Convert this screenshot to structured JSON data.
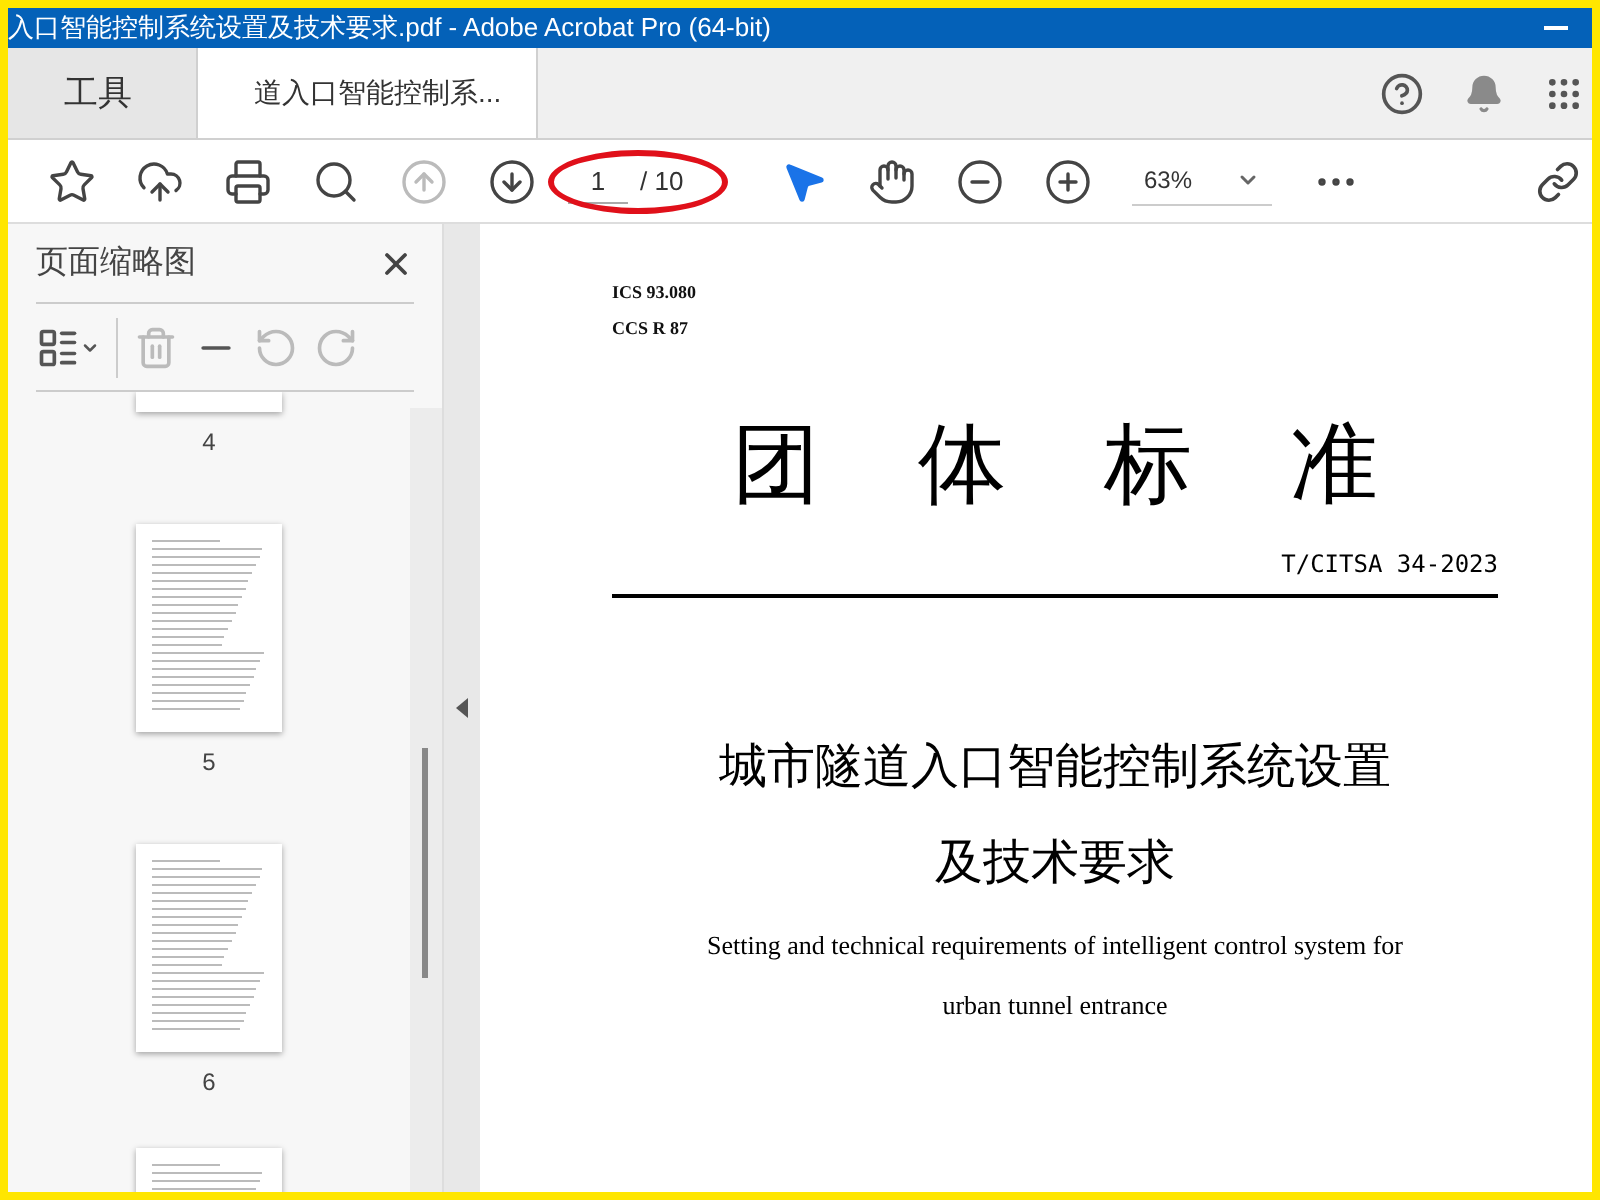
{
  "window": {
    "title": "入口智能控制系统设置及技术要求.pdf - Adobe Acrobat Pro (64-bit)"
  },
  "tabs": [
    {
      "label": "工具",
      "selected": false
    },
    {
      "label": "道入口智能控制系...",
      "selected": true
    }
  ],
  "toolbar": [
    {
      "kind": "star",
      "disabled": false
    },
    {
      "kind": "upload",
      "disabled": false
    },
    {
      "kind": "print",
      "disabled": false
    },
    {
      "kind": "find",
      "disabled": false
    },
    {
      "kind": "prev",
      "disabled": true
    },
    {
      "kind": "next",
      "disabled": false
    },
    {
      "kind": "page"
    },
    {
      "kind": "select",
      "disabled": false
    },
    {
      "kind": "hand",
      "disabled": false
    },
    {
      "kind": "zoom-out",
      "disabled": false
    },
    {
      "kind": "zoom-in",
      "disabled": false
    },
    {
      "kind": "zoom"
    },
    {
      "kind": "more",
      "disabled": false
    }
  ],
  "page_field": {
    "value": "1",
    "total": "/ 10",
    "annotated": true
  },
  "zoom": {
    "value": "63%"
  },
  "sidebar": {
    "title": "页面缩略图",
    "tools": [
      {
        "kind": "options",
        "disabled": false
      },
      {
        "kind": "delete",
        "disabled": true
      },
      {
        "kind": "insert",
        "disabled": false
      },
      {
        "kind": "undo",
        "disabled": true
      },
      {
        "kind": "redo",
        "disabled": true
      }
    ],
    "thumbnails": [
      {
        "label": "4",
        "kind": "cut-top"
      },
      {
        "label": "5",
        "kind": "full"
      },
      {
        "label": "6",
        "kind": "full"
      },
      {
        "kind": "cut-bottom"
      }
    ]
  },
  "document": {
    "ics": "ICS 93.080",
    "ccs": "CCS R 87",
    "heading": [
      "团",
      "体",
      "标",
      "准"
    ],
    "number": "T/CITSA 34-2023",
    "title_lines": [
      "城市隧道入口智能控制系统设置",
      "及技术要求"
    ],
    "english_lines": [
      "Setting and technical requirements of intelligent control system for",
      "urban tunnel entrance"
    ]
  }
}
